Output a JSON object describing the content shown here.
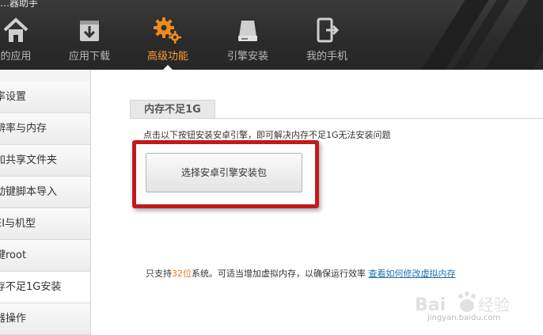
{
  "app": {
    "title": "…器助手"
  },
  "tabs": [
    {
      "label": "的应用",
      "icon": "home-icon"
    },
    {
      "label": "应用下载",
      "icon": "download-box-icon"
    },
    {
      "label": "高级功能",
      "icon": "gears-icon",
      "active": true
    },
    {
      "label": "引擎安装",
      "icon": "drive-icon"
    },
    {
      "label": "我的手机",
      "icon": "phone-export-icon"
    }
  ],
  "sidebar": {
    "items": [
      {
        "label": "率设置"
      },
      {
        "label": "辨率与内存"
      },
      {
        "label": "加共享文件夹"
      },
      {
        "label": "动键脚本导入"
      },
      {
        "label": "EI与机型"
      },
      {
        "label": "键root"
      },
      {
        "label": "存不足1G安装",
        "active": true
      },
      {
        "label": "器操作"
      }
    ]
  },
  "main": {
    "section_title": "内存不足1G",
    "hint": "点击以下按钮安装安卓引擎，即可解决内存不足1G无法安装问题",
    "install_button": "选择安卓引擎安装包",
    "note": {
      "prefix": "只支持",
      "bits": "32位",
      "suffix": "系统。可适当增加虚拟内存，以确保运行效率",
      "link": "查看如何修改虚拟内存"
    }
  },
  "watermark": {
    "text": "jingyan.baidu.com"
  },
  "colors": {
    "accent": "#ff9b2e",
    "link": "#1f6fb5",
    "highlight": "#c21a1a"
  }
}
